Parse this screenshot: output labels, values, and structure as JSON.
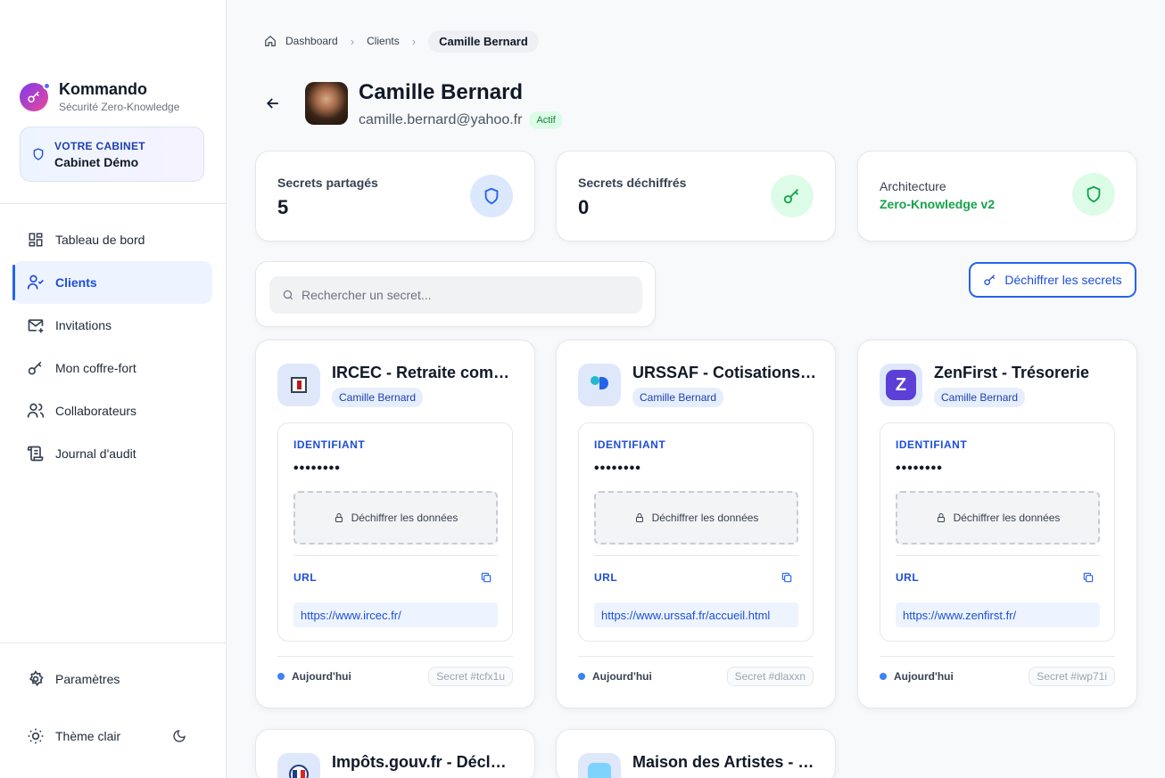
{
  "brand": {
    "name": "Kommando",
    "subtitle": "Sécurité Zero-Knowledge"
  },
  "cabinet": {
    "label": "VOTRE CABINET",
    "name": "Cabinet Démo"
  },
  "nav": [
    {
      "label": "Tableau de bord",
      "icon": "dashboard-icon"
    },
    {
      "label": "Clients",
      "icon": "user-check-icon",
      "active": true
    },
    {
      "label": "Invitations",
      "icon": "mail-plus-icon"
    },
    {
      "label": "Mon coffre-fort",
      "icon": "key-icon"
    },
    {
      "label": "Collaborateurs",
      "icon": "users-icon"
    },
    {
      "label": "Journal d'audit",
      "icon": "scroll-icon"
    }
  ],
  "bottom": {
    "settings": "Paramètres",
    "theme": "Thème clair"
  },
  "breadcrumb": {
    "home": "Dashboard",
    "clients": "Clients",
    "current": "Camille Bernard"
  },
  "client": {
    "name": "Camille Bernard",
    "email": "camille.bernard@yahoo.fr",
    "status": "Actif"
  },
  "stats": {
    "shared": {
      "label": "Secrets partagés",
      "value": "5"
    },
    "decrypted": {
      "label": "Secrets déchiffrés",
      "value": "0"
    },
    "architecture": {
      "label": "Architecture",
      "value": "Zero-Knowledge v2"
    }
  },
  "search": {
    "placeholder": "Rechercher un secret..."
  },
  "decrypt_all": "Déchiffrer les secrets",
  "cards": [
    {
      "title": "IRCEC - Retraite comp…",
      "tag": "Camille Bernard",
      "id_label": "IDENTIFIANT",
      "masked": "••••••••",
      "decrypt": "Déchiffrer les données",
      "url_label": "URL",
      "url": "https://www.ircec.fr/",
      "date": "Aujourd'hui",
      "secret_id": "Secret #tcfx1u"
    },
    {
      "title": "URSSAF - Cotisations …",
      "tag": "Camille Bernard",
      "id_label": "IDENTIFIANT",
      "masked": "••••••••",
      "decrypt": "Déchiffrer les données",
      "url_label": "URL",
      "url": "https://www.urssaf.fr/accueil.html",
      "date": "Aujourd'hui",
      "secret_id": "Secret #dlaxxn"
    },
    {
      "title": "ZenFirst - Trésorerie",
      "tag": "Camille Bernard",
      "id_label": "IDENTIFIANT",
      "masked": "••••••••",
      "decrypt": "Déchiffrer les données",
      "url_label": "URL",
      "url": "https://www.zenfirst.fr/",
      "date": "Aujourd'hui",
      "secret_id": "Secret #iwp71i"
    },
    {
      "title": "Impôts.gouv.fr - Décl…"
    },
    {
      "title": "Maison des Artistes - …"
    }
  ]
}
